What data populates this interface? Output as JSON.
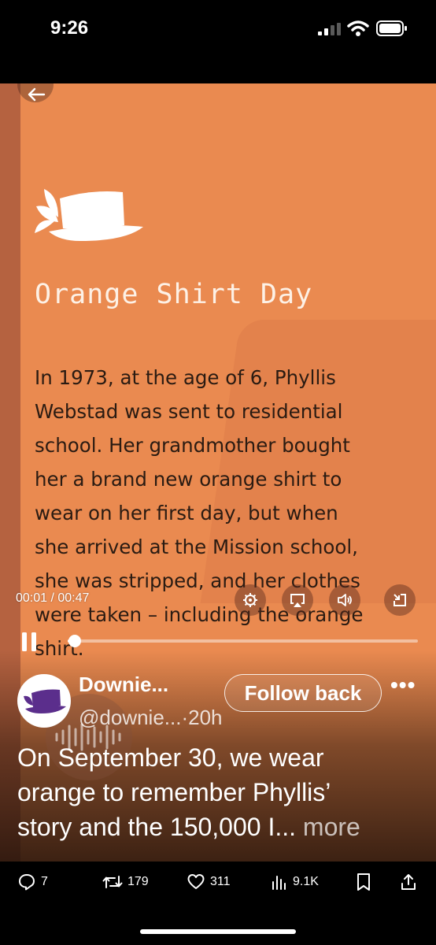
{
  "status_bar": {
    "time": "9:26"
  },
  "slide": {
    "title": "Orange Shirt Day",
    "body_lines": [
      "In 1973, at the age of 6, Phyllis",
      "Webstad was sent to residential",
      "school. Her grandmother bought",
      "her a brand new orange shirt to",
      "wear on her first day, but when",
      "she arrived at the Mission school,",
      "she was stripped, and her clothes",
      "were taken – including the orange",
      "shirt."
    ]
  },
  "player": {
    "time_display": "00:01 / 00:47",
    "progress_fraction": 0.02
  },
  "author": {
    "name": "Downie...",
    "handle": "@downie...",
    "time_sep": "·",
    "age": "20h",
    "follow_label": "Follow back",
    "more_glyph": "•••"
  },
  "tweet": {
    "lines": [
      "On September 30, we wear",
      "orange to remember Phyllis’",
      "story and the 150,000 I..."
    ],
    "more_label": "more"
  },
  "actions": {
    "replies": "7",
    "reposts": "179",
    "likes": "311",
    "views": "9.1K"
  },
  "colors": {
    "slide_bg": "#ea8a50",
    "slide_title": "#fdf1e6",
    "slide_text": "#2a1b12",
    "avatar_hat": "#5b2e8c"
  }
}
